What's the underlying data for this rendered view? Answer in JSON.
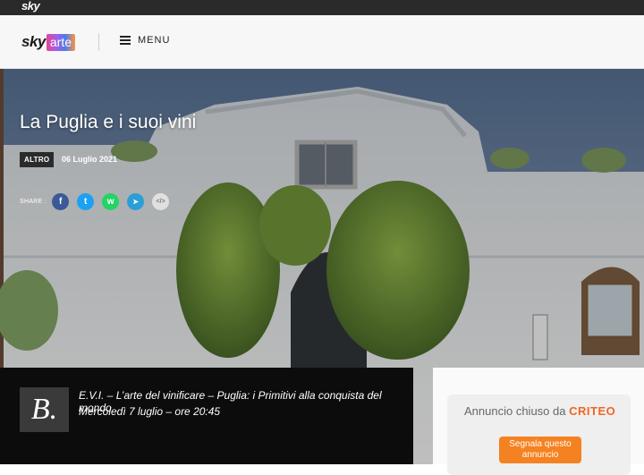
{
  "topbar": {
    "brand": "sky"
  },
  "header": {
    "logo_sky": "sky",
    "logo_arte": "arte",
    "menu_label": "MENU"
  },
  "article": {
    "title": "La Puglia e i suoi vini",
    "tag": "ALTRO",
    "date": "06 Luglio 2021"
  },
  "share": {
    "label": "SHARE :",
    "buttons": [
      {
        "icon": "facebook-icon",
        "glyph": "f",
        "color": "#3b5998"
      },
      {
        "icon": "twitter-icon",
        "glyph": "t",
        "color": "#1da1f2"
      },
      {
        "icon": "whatsapp-icon",
        "glyph": "w",
        "color": "#25d366"
      },
      {
        "icon": "telegram-icon",
        "glyph": "➤",
        "color": "#2a9fd6"
      },
      {
        "icon": "embed-icon",
        "glyph": "</>",
        "color": "#e0e0e0"
      }
    ]
  },
  "promo": {
    "badge": "B.",
    "line1": "E.V.I. – L’arte del vinificare – Puglia: i Primitivi alla conquista del mondo",
    "line2": "Mercoledì 7 luglio – ore 20:45"
  },
  "ad": {
    "text": "Annuncio chiuso da",
    "brand": "CRITEO",
    "button": "Segnala questo annuncio"
  }
}
